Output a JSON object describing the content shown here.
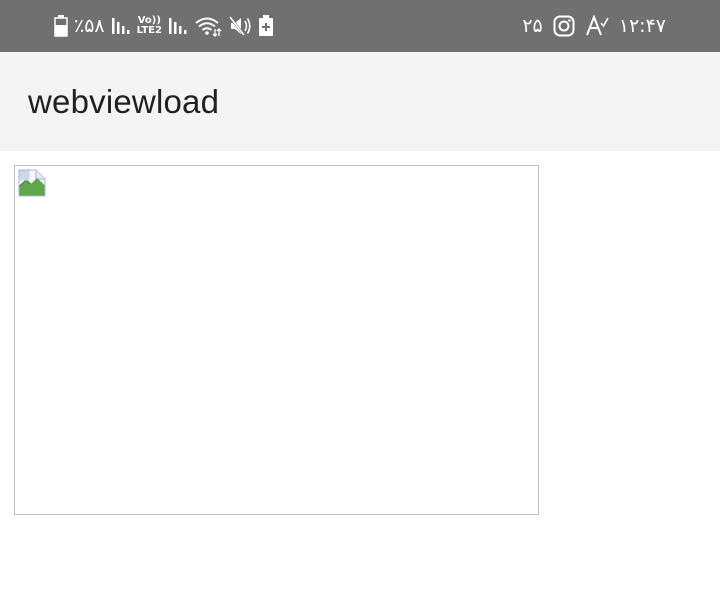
{
  "status_bar": {
    "battery_text": "٪۵۸",
    "network_badge_top": "Vo))",
    "network_badge_bottom": "LTE2",
    "notification_count": "۲۵",
    "clock": "۱۲:۴۷",
    "background_color": "#707070",
    "left_icons": [
      "battery-icon",
      "signal-icon",
      "signal-icon",
      "wifi-icon",
      "mute-icon",
      "battery-saver-icon"
    ],
    "right_icons": [
      "instagram-icon",
      "text-translate-icon"
    ]
  },
  "app_bar": {
    "title": "webviewload",
    "background_color": "#f4f4f4"
  },
  "webview": {
    "broken_image_icon": "broken-image-icon"
  }
}
